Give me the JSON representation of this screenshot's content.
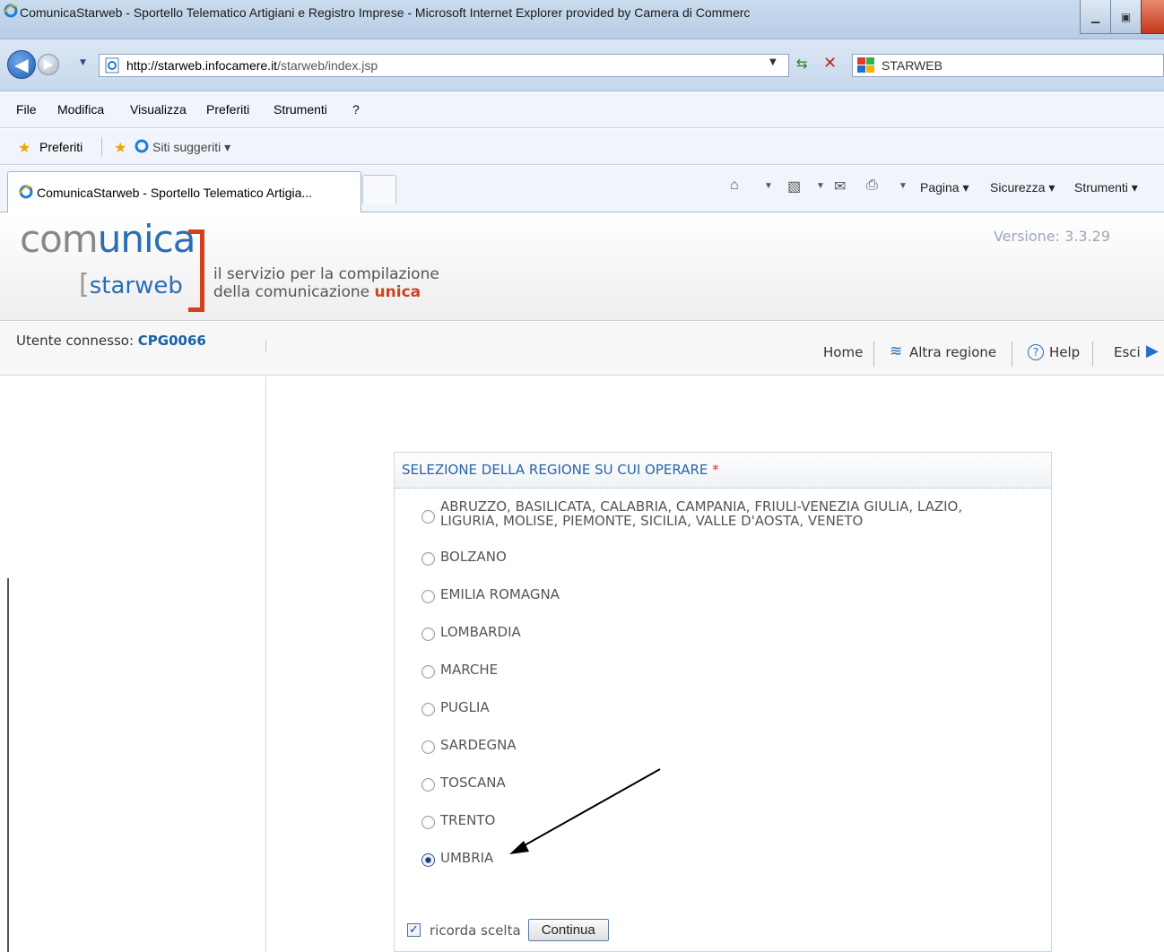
{
  "browser": {
    "window_title": "ComunicaStarweb - Sportello Telematico Artigiani e Registro Imprese - Microsoft Internet Explorer provided by Camera di Commerc",
    "url_host": "http://starweb.infocamere.it",
    "url_path": "/starweb/index.jsp",
    "search_provider": "STARWEB",
    "menu": [
      "File",
      "Modifica",
      "Visualizza",
      "Preferiti",
      "Strumenti",
      "?"
    ],
    "favorites_label": "Preferiti",
    "suggested_sites": "Siti suggeriti ▾",
    "tab_title": "ComunicaStarweb - Sportello Telematico Artigia...",
    "commands": {
      "page": "Pagina ▾",
      "security": "Sicurezza ▾",
      "tools": "Strumenti ▾"
    }
  },
  "header": {
    "logo_main_prefix": "com",
    "logo_main_suffix": "unica",
    "logo_sub": "starweb",
    "tagline_line1": "il servizio per la compilazione",
    "tagline_line2_prefix": "della comunicazione ",
    "tagline_line2_highlight": "unica",
    "version": "Versione: 3.3.29"
  },
  "userbar": {
    "label": "Utente connesso: ",
    "user": "CPG0066",
    "links": {
      "home": "Home",
      "region": "Altra regione",
      "help": "Help",
      "exit": "Esci"
    }
  },
  "form": {
    "title": "SELEZIONE DELLA REGIONE SU CUI OPERARE",
    "required_mark": "*",
    "options": [
      {
        "label": "ABRUZZO, BASILICATA, CALABRIA, CAMPANIA, FRIULI-VENEZIA GIULIA, LAZIO, LIGURIA, MOLISE, PIEMONTE, SICILIA, VALLE D'AOSTA, VENETO",
        "selected": false
      },
      {
        "label": "BOLZANO",
        "selected": false
      },
      {
        "label": "EMILIA ROMAGNA",
        "selected": false
      },
      {
        "label": "LOMBARDIA",
        "selected": false
      },
      {
        "label": "MARCHE",
        "selected": false
      },
      {
        "label": "PUGLIA",
        "selected": false
      },
      {
        "label": "SARDEGNA",
        "selected": false
      },
      {
        "label": "TOSCANA",
        "selected": false
      },
      {
        "label": "TRENTO",
        "selected": false
      },
      {
        "label": "UMBRIA",
        "selected": true
      }
    ],
    "remember_label": "ricorda scelta",
    "remember_checked": true,
    "submit_label": "Continua"
  }
}
